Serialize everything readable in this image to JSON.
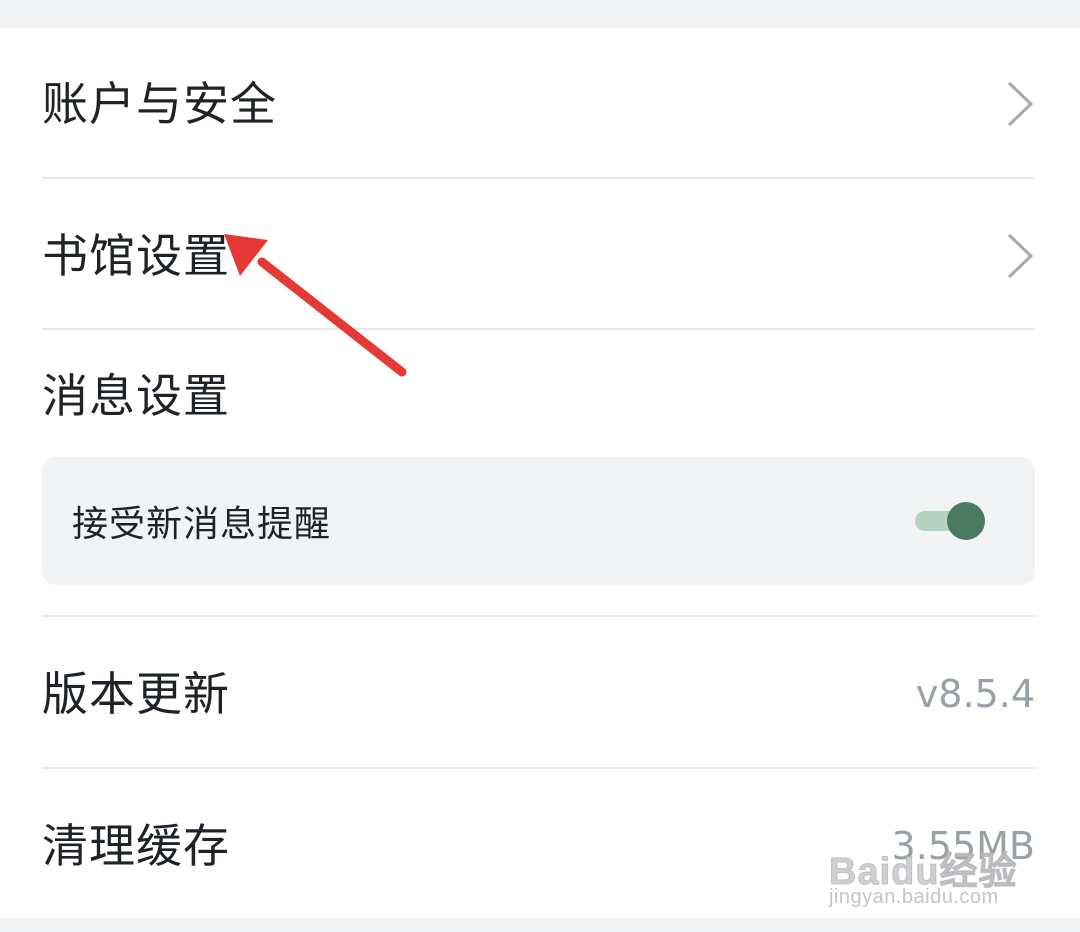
{
  "settings": {
    "account_security": {
      "label": "账户与安全"
    },
    "library_settings": {
      "label": "书馆设置"
    },
    "message_settings": {
      "label": "消息设置",
      "receive_notifications": {
        "label": "接受新消息提醒",
        "enabled": true
      }
    },
    "version_update": {
      "label": "版本更新",
      "value": "v8.5.4"
    },
    "clear_cache": {
      "label": "清理缓存",
      "value": "3.55MB"
    }
  },
  "icons": {
    "chevron": "chevron-right-icon",
    "annotation": "red-arrow-annotation"
  },
  "colors": {
    "toggle_on_knob": "#4a7a64",
    "toggle_on_track": "#b5d3c3",
    "annotation_arrow": "#e53935",
    "text_primary": "#1f2329",
    "text_secondary": "#9aa0a8"
  },
  "watermark": {
    "brand": "Baidu经验",
    "url": "jingyan.baidu.com"
  }
}
